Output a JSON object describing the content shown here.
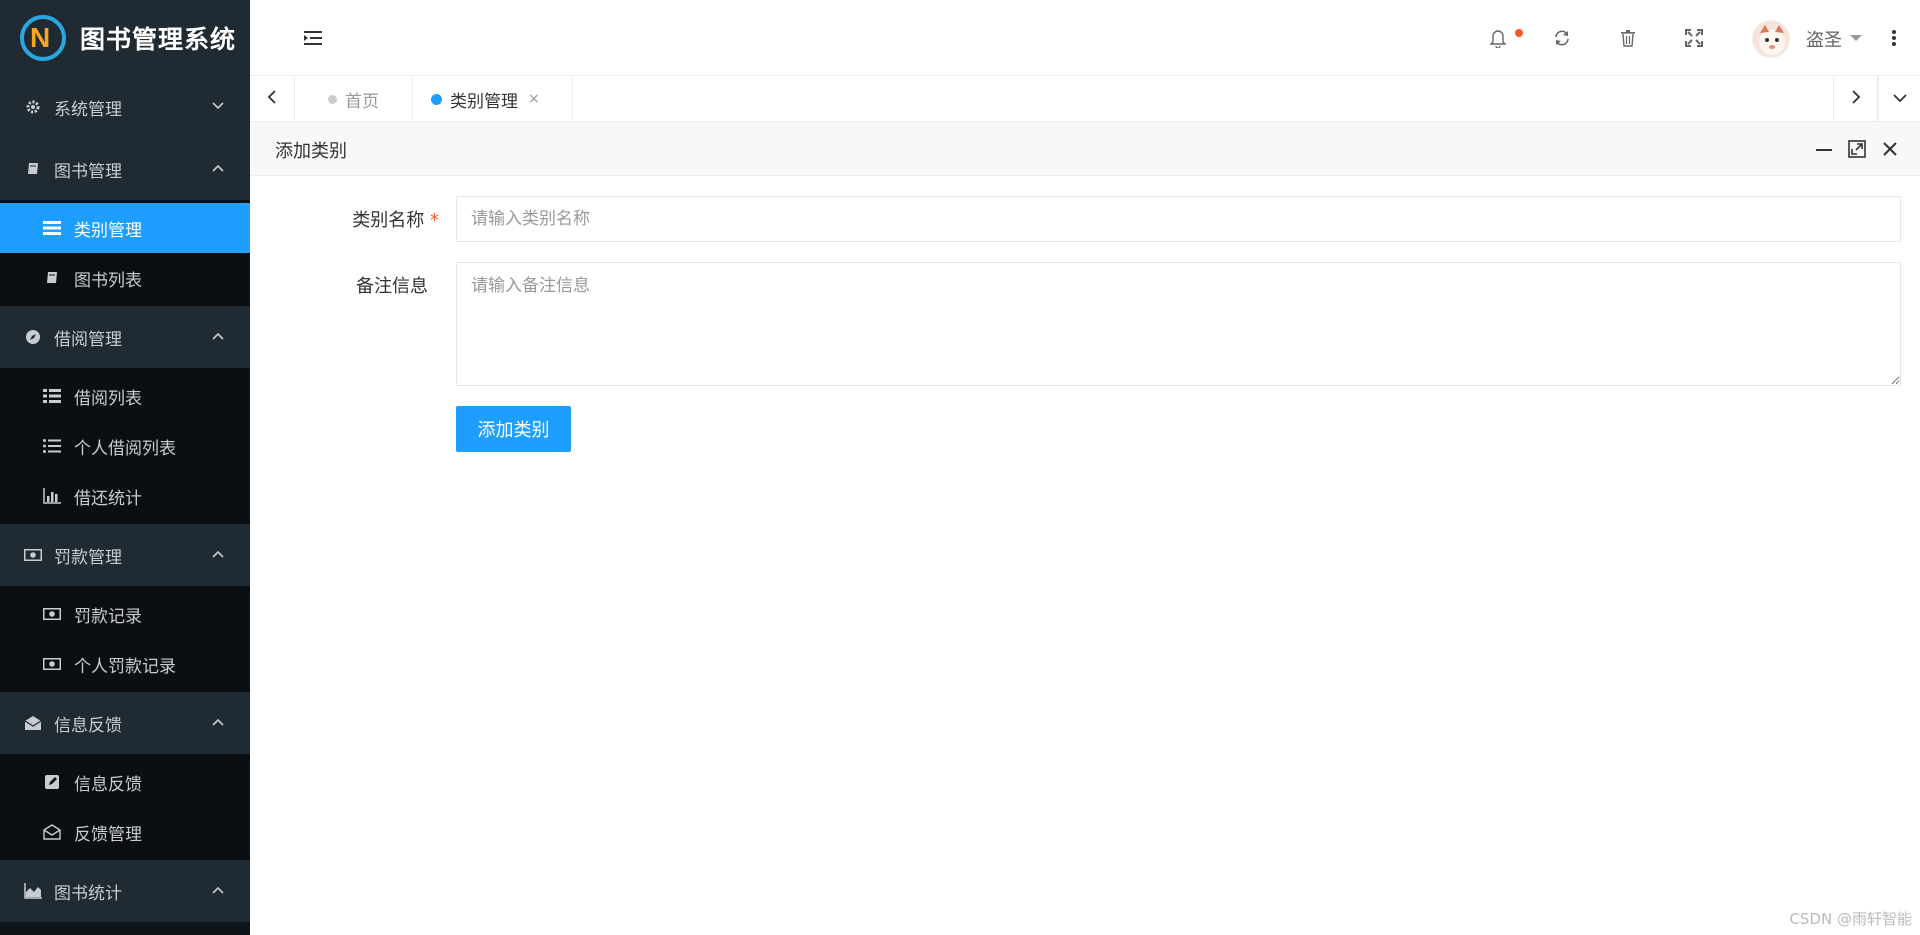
{
  "app": {
    "title": "图书管理系统",
    "logo_letter": "N"
  },
  "sidebar": {
    "groups": [
      {
        "label": "系统管理",
        "icon": "gear-icon",
        "expanded": false,
        "items": []
      },
      {
        "label": "图书管理",
        "icon": "book-icon",
        "expanded": true,
        "items": [
          {
            "label": "类别管理",
            "icon": "list-icon",
            "active": true
          },
          {
            "label": "图书列表",
            "icon": "book-icon",
            "active": false
          }
        ]
      },
      {
        "label": "借阅管理",
        "icon": "compass-icon",
        "expanded": true,
        "items": [
          {
            "label": "借阅列表",
            "icon": "table-list-icon"
          },
          {
            "label": "个人借阅列表",
            "icon": "bullet-list-icon"
          },
          {
            "label": "借还统计",
            "icon": "bar-chart-icon"
          }
        ]
      },
      {
        "label": "罚款管理",
        "icon": "money-icon",
        "expanded": true,
        "items": [
          {
            "label": "罚款记录",
            "icon": "money-icon"
          },
          {
            "label": "个人罚款记录",
            "icon": "money-icon"
          }
        ]
      },
      {
        "label": "信息反馈",
        "icon": "envelope-open-icon",
        "expanded": true,
        "items": [
          {
            "label": "信息反馈",
            "icon": "edit-icon"
          },
          {
            "label": "反馈管理",
            "icon": "envelope-outline-icon"
          }
        ]
      },
      {
        "label": "图书统计",
        "icon": "area-chart-icon",
        "expanded": true,
        "items": []
      }
    ]
  },
  "header": {
    "username": "盗圣",
    "colors": {
      "notification_dot": "#ff5722"
    }
  },
  "tabs": {
    "items": [
      {
        "label": "首页",
        "active": false
      },
      {
        "label": "类别管理",
        "active": true,
        "close": "×"
      }
    ]
  },
  "panel": {
    "title": "添加类别"
  },
  "form": {
    "name_label": "类别名称",
    "required_mark": "*",
    "name_placeholder": "请输入类别名称",
    "remark_label": "备注信息",
    "remark_placeholder": "请输入备注信息",
    "submit_label": "添加类别"
  },
  "watermark": "CSDN @雨轩智能",
  "colors": {
    "accent": "#1e9fff",
    "sidebar_bg": "#0f1418",
    "sidebar_group_bg": "#1f2a32"
  }
}
